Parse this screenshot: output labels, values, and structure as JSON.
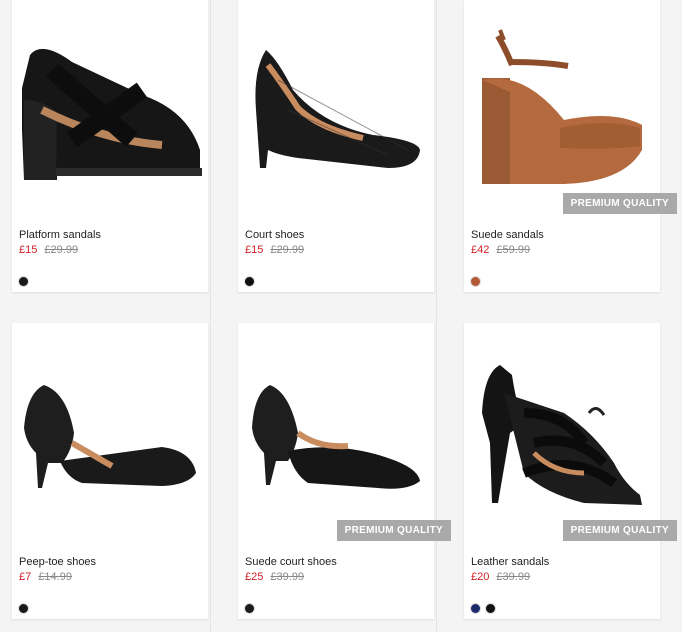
{
  "products": [
    {
      "name": "Platform sandals",
      "price": "£15",
      "old_price": "£29.99",
      "badge": "",
      "swatches": [
        {
          "color": "#1a1a1a"
        }
      ]
    },
    {
      "name": "Court shoes",
      "price": "£15",
      "old_price": "£29.99",
      "badge": "",
      "swatches": [
        {
          "color": "#111111"
        }
      ]
    },
    {
      "name": "Suede sandals",
      "price": "£42",
      "old_price": "£59.99",
      "badge": "PREMIUM QUALITY",
      "swatches": [
        {
          "color": "#b25a35"
        }
      ]
    },
    {
      "name": "Peep-toe shoes",
      "price": "£7",
      "old_price": "£14.99",
      "badge": "",
      "swatches": [
        {
          "color": "#1a1a1a"
        }
      ]
    },
    {
      "name": "Suede court shoes",
      "price": "£25",
      "old_price": "£39.99",
      "badge": "PREMIUM QUALITY",
      "swatches": [
        {
          "color": "#1a1a1a"
        }
      ]
    },
    {
      "name": "Leather sandals",
      "price": "£20",
      "old_price": "£39.99",
      "badge": "PREMIUM QUALITY",
      "swatches": [
        {
          "color": "#1c2a6b"
        },
        {
          "color": "#111111"
        }
      ]
    }
  ],
  "colors": {
    "sale": "#d01f26",
    "badge_bg": "#a9a9a9"
  }
}
